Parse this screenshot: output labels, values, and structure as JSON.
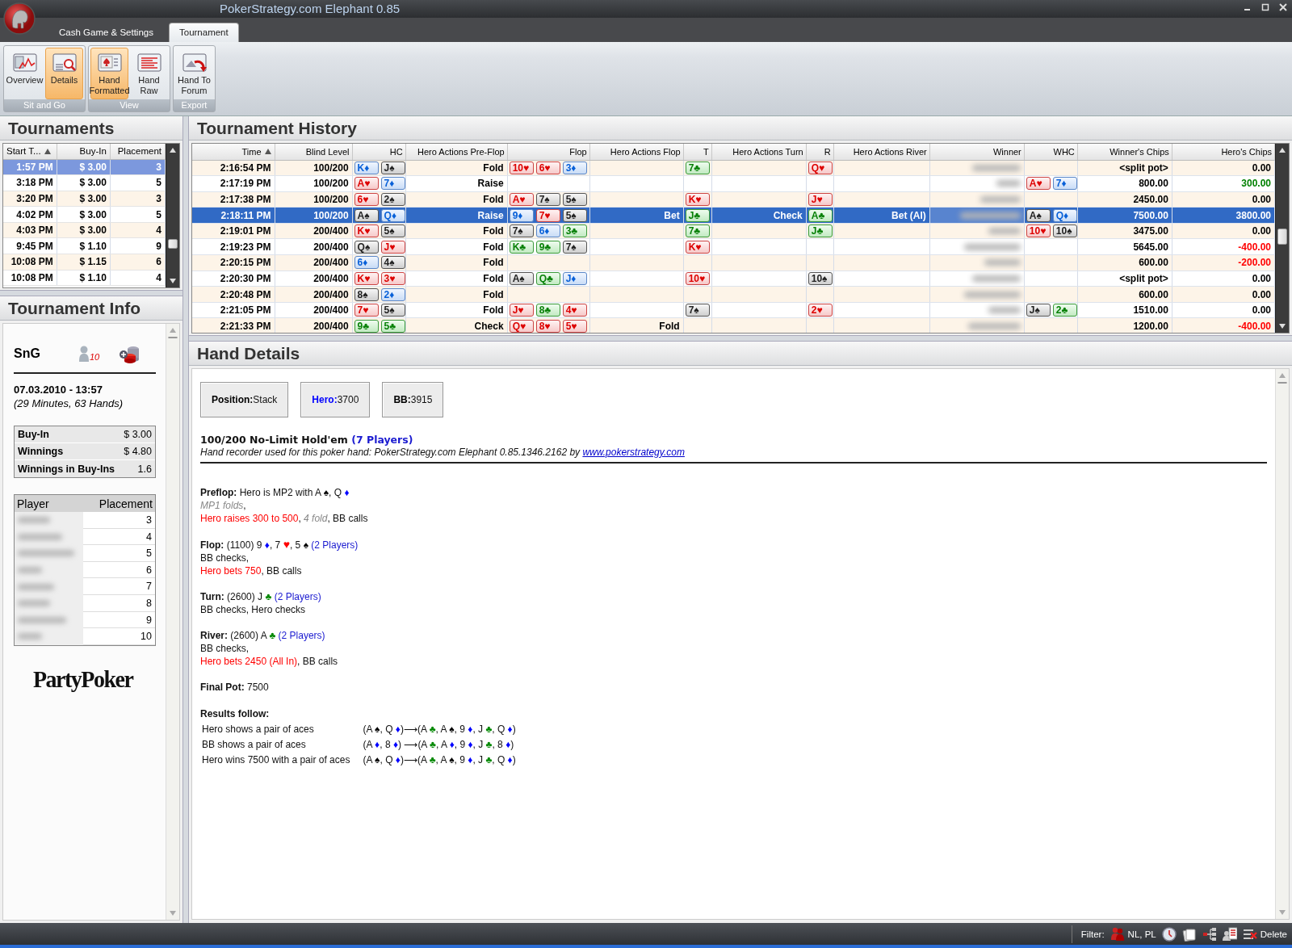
{
  "window": {
    "title": "PokerStrategy.com Elephant 0.85"
  },
  "ribbon": {
    "tabs": [
      {
        "label": "Cash Game & Settings",
        "selected": false
      },
      {
        "label": "Tournament",
        "selected": true
      }
    ],
    "groups": [
      {
        "label": "Sit and Go",
        "buttons": [
          {
            "label": "Overview",
            "kind": "chart",
            "selected": false
          },
          {
            "label": "Details",
            "kind": "details",
            "selected": true
          }
        ]
      },
      {
        "label": "View",
        "buttons": [
          {
            "label": "Hand Formatted",
            "kind": "hand",
            "selected": true
          },
          {
            "label": "Hand Raw",
            "kind": "raw",
            "selected": false
          }
        ]
      },
      {
        "label": "Export",
        "buttons": [
          {
            "label": "Hand To Forum",
            "kind": "forum",
            "selected": false
          }
        ]
      }
    ]
  },
  "tournaments": {
    "title": "Tournaments",
    "columns": [
      {
        "label": "Start T...",
        "sorted": true
      },
      {
        "label": "Buy-In",
        "sorted": false
      },
      {
        "label": "Placement",
        "sorted": false
      }
    ],
    "rows": [
      {
        "start": "1:57 PM",
        "buy_in": "$ 3.00",
        "placement": "3",
        "selected": true
      },
      {
        "start": "3:18 PM",
        "buy_in": "$ 3.00",
        "placement": "5",
        "selected": false
      },
      {
        "start": "3:20 PM",
        "buy_in": "$ 3.00",
        "placement": "3",
        "selected": false
      },
      {
        "start": "4:02 PM",
        "buy_in": "$ 3.00",
        "placement": "5",
        "selected": false
      },
      {
        "start": "4:03 PM",
        "buy_in": "$ 3.00",
        "placement": "4",
        "selected": false
      },
      {
        "start": "9:45 PM",
        "buy_in": "$ 1.10",
        "placement": "9",
        "selected": false
      },
      {
        "start": "10:08 PM",
        "buy_in": "$ 1.15",
        "placement": "6",
        "selected": false
      },
      {
        "start": "10:08 PM",
        "buy_in": "$ 1.10",
        "placement": "4",
        "selected": false
      }
    ]
  },
  "tournament_info": {
    "title": "Tournament Info",
    "type": "SnG",
    "player_count": "10",
    "date": "07.03.2010 - 13:57",
    "duration": "(29 Minutes, 63 Hands)",
    "summary": [
      {
        "label": "Buy-In",
        "value": "$ 3.00"
      },
      {
        "label": "Winnings",
        "value": "$ 4.80"
      },
      {
        "label": "Winnings in Buy-Ins",
        "value": "1.6"
      }
    ],
    "players": {
      "columns": [
        "Player",
        "Placement"
      ],
      "rows": [
        {
          "placement": "3"
        },
        {
          "placement": "4"
        },
        {
          "placement": "5"
        },
        {
          "placement": "6"
        },
        {
          "placement": "7"
        },
        {
          "placement": "8"
        },
        {
          "placement": "9"
        },
        {
          "placement": "10"
        }
      ]
    },
    "logo": "PartyPoker"
  },
  "history": {
    "title": "Tournament History",
    "columns": [
      {
        "label": "Time",
        "sorted": true
      },
      {
        "label": "Blind Level",
        "sorted": false
      },
      {
        "label": "HC",
        "sorted": false
      },
      {
        "label": "Hero Actions Pre-Flop",
        "sorted": false
      },
      {
        "label": "Flop",
        "sorted": false
      },
      {
        "label": "Hero Actions Flop",
        "sorted": false
      },
      {
        "label": "T",
        "sorted": false
      },
      {
        "label": "Hero Actions Turn",
        "sorted": false
      },
      {
        "label": "R",
        "sorted": false
      },
      {
        "label": "Hero Actions River",
        "sorted": false
      },
      {
        "label": "Winner",
        "sorted": false
      },
      {
        "label": "WHC",
        "sorted": false
      },
      {
        "label": "Winner's Chips",
        "sorted": false
      },
      {
        "label": "Hero's Chips",
        "sorted": false
      }
    ],
    "rows": [
      {
        "time": "2:16:54 PM",
        "blind": "100/200",
        "hc": [
          {
            "label": "K♦",
            "kind": "diamonds"
          },
          {
            "label": "J♠",
            "kind": "spades"
          }
        ],
        "pre": "Fold",
        "flop": [
          {
            "label": "10♥",
            "kind": "hearts"
          },
          {
            "label": "6♥",
            "kind": "hearts"
          },
          {
            "label": "3♦",
            "kind": "diamonds"
          }
        ],
        "turn": [
          {
            "label": "7♣",
            "kind": "clubs"
          }
        ],
        "river": [
          {
            "label": "Q♥",
            "kind": "hearts"
          }
        ],
        "winners_chips": "<split pot>",
        "heros_chips": "0.00",
        "color": "#000000",
        "selected": false
      },
      {
        "time": "2:17:19 PM",
        "blind": "100/200",
        "hc": [
          {
            "label": "A♥",
            "kind": "hearts"
          },
          {
            "label": "7♦",
            "kind": "diamonds"
          }
        ],
        "pre": "Raise",
        "whc": [
          {
            "label": "A♥",
            "kind": "hearts"
          },
          {
            "label": "7♦",
            "kind": "diamonds"
          }
        ],
        "winners_chips": "800.00",
        "heros_chips": "300.00",
        "color": "#008000",
        "selected": false
      },
      {
        "time": "2:17:38 PM",
        "blind": "100/200",
        "hc": [
          {
            "label": "6♥",
            "kind": "hearts"
          },
          {
            "label": "2♠",
            "kind": "spades"
          }
        ],
        "pre": "Fold",
        "flop": [
          {
            "label": "A♥",
            "kind": "hearts"
          },
          {
            "label": "7♠",
            "kind": "spades"
          },
          {
            "label": "5♠",
            "kind": "spades"
          }
        ],
        "turn": [
          {
            "label": "K♥",
            "kind": "hearts"
          }
        ],
        "river": [
          {
            "label": "J♥",
            "kind": "hearts"
          }
        ],
        "winners_chips": "2450.00",
        "heros_chips": "0.00",
        "color": "#000000",
        "selected": false
      },
      {
        "time": "2:18:11 PM",
        "blind": "100/200",
        "hc": [
          {
            "label": "A♠",
            "kind": "spades"
          },
          {
            "label": "Q♦",
            "kind": "diamonds"
          }
        ],
        "pre": "Raise",
        "flop": [
          {
            "label": "9♦",
            "kind": "diamonds"
          },
          {
            "label": "7♥",
            "kind": "hearts"
          },
          {
            "label": "5♠",
            "kind": "spades"
          }
        ],
        "flop_action": "Bet",
        "turn": [
          {
            "label": "J♣",
            "kind": "clubs"
          }
        ],
        "turn_action": "Check",
        "river": [
          {
            "label": "A♣",
            "kind": "clubs"
          }
        ],
        "river_action": "Bet (AI)",
        "whc": [
          {
            "label": "A♠",
            "kind": "spades"
          },
          {
            "label": "Q♦",
            "kind": "diamonds"
          }
        ],
        "winners_chips": "7500.00",
        "heros_chips": "3800.00",
        "selected": true
      },
      {
        "time": "2:19:01 PM",
        "blind": "200/400",
        "hc": [
          {
            "label": "K♥",
            "kind": "hearts"
          },
          {
            "label": "5♠",
            "kind": "spades"
          }
        ],
        "pre": "Fold",
        "flop": [
          {
            "label": "7♠",
            "kind": "spades"
          },
          {
            "label": "6♦",
            "kind": "diamonds"
          },
          {
            "label": "3♣",
            "kind": "clubs"
          }
        ],
        "turn": [
          {
            "label": "7♣",
            "kind": "clubs"
          }
        ],
        "river": [
          {
            "label": "J♣",
            "kind": "clubs"
          }
        ],
        "whc": [
          {
            "label": "10♥",
            "kind": "hearts"
          },
          {
            "label": "10♠",
            "kind": "spades"
          }
        ],
        "winners_chips": "3475.00",
        "heros_chips": "0.00",
        "color": "#000000",
        "selected": false
      },
      {
        "time": "2:19:23 PM",
        "blind": "200/400",
        "hc": [
          {
            "label": "Q♠",
            "kind": "spades"
          },
          {
            "label": "J♥",
            "kind": "hearts"
          }
        ],
        "pre": "Fold",
        "flop": [
          {
            "label": "K♣",
            "kind": "clubs"
          },
          {
            "label": "9♣",
            "kind": "clubs"
          },
          {
            "label": "7♠",
            "kind": "spades"
          }
        ],
        "turn": [
          {
            "label": "K♥",
            "kind": "hearts"
          }
        ],
        "winners_chips": "5645.00",
        "heros_chips": "-400.00",
        "color": "#ff0000",
        "selected": false
      },
      {
        "time": "2:20:15 PM",
        "blind": "200/400",
        "hc": [
          {
            "label": "6♦",
            "kind": "diamonds"
          },
          {
            "label": "4♠",
            "kind": "spades"
          }
        ],
        "pre": "Fold",
        "winners_chips": "600.00",
        "heros_chips": "-200.00",
        "color": "#ff0000",
        "selected": false
      },
      {
        "time": "2:20:30 PM",
        "blind": "200/400",
        "hc": [
          {
            "label": "K♥",
            "kind": "hearts"
          },
          {
            "label": "3♥",
            "kind": "hearts"
          }
        ],
        "pre": "Fold",
        "flop": [
          {
            "label": "A♠",
            "kind": "spades"
          },
          {
            "label": "Q♣",
            "kind": "clubs"
          },
          {
            "label": "J♦",
            "kind": "diamonds"
          }
        ],
        "turn": [
          {
            "label": "10♥",
            "kind": "hearts"
          }
        ],
        "river": [
          {
            "label": "10♠",
            "kind": "spades"
          }
        ],
        "winners_chips": "<split pot>",
        "heros_chips": "0.00",
        "color": "#000000",
        "selected": false
      },
      {
        "time": "2:20:48 PM",
        "blind": "200/400",
        "hc": [
          {
            "label": "8♠",
            "kind": "spades"
          },
          {
            "label": "2♦",
            "kind": "diamonds"
          }
        ],
        "pre": "Fold",
        "winners_chips": "600.00",
        "heros_chips": "0.00",
        "color": "#000000",
        "selected": false
      },
      {
        "time": "2:21:05 PM",
        "blind": "200/400",
        "hc": [
          {
            "label": "7♥",
            "kind": "hearts"
          },
          {
            "label": "5♠",
            "kind": "spades"
          }
        ],
        "pre": "Fold",
        "flop": [
          {
            "label": "J♥",
            "kind": "hearts"
          },
          {
            "label": "8♣",
            "kind": "clubs"
          },
          {
            "label": "4♥",
            "kind": "hearts"
          }
        ],
        "turn": [
          {
            "label": "7♠",
            "kind": "spades"
          }
        ],
        "river": [
          {
            "label": "2♥",
            "kind": "hearts"
          }
        ],
        "whc": [
          {
            "label": "J♠",
            "kind": "spades"
          },
          {
            "label": "2♣",
            "kind": "clubs"
          }
        ],
        "winners_chips": "1510.00",
        "heros_chips": "0.00",
        "color": "#000000",
        "selected": false
      },
      {
        "time": "2:21:33 PM",
        "blind": "200/400",
        "hc": [
          {
            "label": "9♣",
            "kind": "clubs"
          },
          {
            "label": "5♣",
            "kind": "clubs"
          }
        ],
        "pre": "Check",
        "flop": [
          {
            "label": "Q♥",
            "kind": "hearts"
          },
          {
            "label": "8♥",
            "kind": "hearts"
          },
          {
            "label": "5♥",
            "kind": "hearts"
          }
        ],
        "flop_action": "Fold",
        "winners_chips": "1200.00",
        "heros_chips": "-400.00",
        "color": "#ff0000",
        "selected": false
      }
    ]
  },
  "hand_details": {
    "title": "Hand Details",
    "stats": [
      {
        "label": "Position:",
        "value": "Stack",
        "color": "#000000"
      },
      {
        "label": "Hero:",
        "value": "3700",
        "color": "#0000ff"
      },
      {
        "label": "BB:",
        "value": "3915",
        "color": "#000000"
      }
    ],
    "game": "100/200 No-Limit Hold'em",
    "game_players": "(7 Players)",
    "recorder": "Hand recorder used for this poker hand: PokerStrategy.com Elephant 0.85.1346.2162 by",
    "link": "www.pokerstrategy.com",
    "paragraphs": [
      [
        [
          {
            "text": "Preflop:",
            "kind": "bold"
          },
          {
            "text": " Hero is MP2 with A ",
            "kind": "plain"
          },
          {
            "text": "♠",
            "kind": "spade"
          },
          {
            "text": ", Q ",
            "kind": "plain"
          },
          {
            "text": "♦",
            "kind": "diamond"
          }
        ],
        [
          {
            "text": "MP1 folds",
            "kind": "folded"
          },
          {
            "text": ",",
            "kind": "plain"
          }
        ],
        [
          {
            "text": "Hero raises 300 to 500",
            "kind": "hero"
          },
          {
            "text": ", ",
            "kind": "plain"
          },
          {
            "text": "4 fold",
            "kind": "folded"
          },
          {
            "text": ", BB calls",
            "kind": "plain"
          }
        ]
      ],
      [
        [
          {
            "text": "Flop:",
            "kind": "bold"
          },
          {
            "text": " (1100) 9 ",
            "kind": "plain"
          },
          {
            "text": "♦",
            "kind": "diamond"
          },
          {
            "text": ", 7 ",
            "kind": "plain"
          },
          {
            "text": "♥",
            "kind": "heart"
          },
          {
            "text": ", 5 ",
            "kind": "plain"
          },
          {
            "text": "♠",
            "kind": "spade"
          },
          {
            "text": " (2 Players)",
            "kind": "players"
          }
        ],
        [
          {
            "text": "BB checks,",
            "kind": "plain"
          }
        ],
        [
          {
            "text": "Hero bets 750",
            "kind": "hero"
          },
          {
            "text": ", BB calls",
            "kind": "plain"
          }
        ]
      ],
      [
        [
          {
            "text": "Turn:",
            "kind": "bold"
          },
          {
            "text": " (2600) J ",
            "kind": "plain"
          },
          {
            "text": "♣",
            "kind": "club"
          },
          {
            "text": " (2 Players)",
            "kind": "players"
          }
        ],
        [
          {
            "text": "BB checks, Hero checks",
            "kind": "plain"
          }
        ]
      ],
      [
        [
          {
            "text": "River:",
            "kind": "bold"
          },
          {
            "text": " (2600) A ",
            "kind": "plain"
          },
          {
            "text": "♣",
            "kind": "club"
          },
          {
            "text": " (2 Players)",
            "kind": "players"
          }
        ],
        [
          {
            "text": "BB checks,",
            "kind": "plain"
          }
        ],
        [
          {
            "text": "Hero bets 2450 (All In)",
            "kind": "hero"
          },
          {
            "text": ", BB calls",
            "kind": "plain"
          }
        ]
      ],
      [
        [
          {
            "text": "Final Pot:",
            "kind": "bold"
          },
          {
            "text": " 7500",
            "kind": "plain"
          }
        ]
      ]
    ],
    "results_title": "Results follow:",
    "results": [
      {
        "text": "Hero shows a pair of aces",
        "hand": [
          {
            "text": "(A ",
            "kind": "plain"
          },
          {
            "text": "♠",
            "kind": "spade"
          },
          {
            "text": ", Q ",
            "kind": "plain"
          },
          {
            "text": "♦",
            "kind": "diamond"
          },
          {
            "text": ")⟶(A ",
            "kind": "plain"
          },
          {
            "text": "♣",
            "kind": "club"
          },
          {
            "text": ", A ",
            "kind": "plain"
          },
          {
            "text": "♠",
            "kind": "spade"
          },
          {
            "text": ", 9 ",
            "kind": "plain"
          },
          {
            "text": "♦",
            "kind": "diamond"
          },
          {
            "text": ", J ",
            "kind": "plain"
          },
          {
            "text": "♣",
            "kind": "club"
          },
          {
            "text": ", Q ",
            "kind": "plain"
          },
          {
            "text": "♦",
            "kind": "diamond"
          },
          {
            "text": ")",
            "kind": "plain"
          }
        ]
      },
      {
        "text": "BB shows a pair of aces",
        "hand": [
          {
            "text": "(A ",
            "kind": "plain"
          },
          {
            "text": "♦",
            "kind": "diamond"
          },
          {
            "text": ", 8 ",
            "kind": "plain"
          },
          {
            "text": "♦",
            "kind": "diamond"
          },
          {
            "text": ") ⟶(A ",
            "kind": "plain"
          },
          {
            "text": "♣",
            "kind": "club"
          },
          {
            "text": ", A ",
            "kind": "plain"
          },
          {
            "text": "♦",
            "kind": "diamond"
          },
          {
            "text": ", 9 ",
            "kind": "plain"
          },
          {
            "text": "♦",
            "kind": "diamond"
          },
          {
            "text": ", J ",
            "kind": "plain"
          },
          {
            "text": "♣",
            "kind": "club"
          },
          {
            "text": ", 8 ",
            "kind": "plain"
          },
          {
            "text": "♦",
            "kind": "diamond"
          },
          {
            "text": ")",
            "kind": "plain"
          }
        ]
      },
      {
        "text": "Hero wins 7500 with a pair of aces",
        "hand": [
          {
            "text": "(A ",
            "kind": "plain"
          },
          {
            "text": "♠",
            "kind": "spade"
          },
          {
            "text": ", Q ",
            "kind": "plain"
          },
          {
            "text": "♦",
            "kind": "diamond"
          },
          {
            "text": ")⟶(A ",
            "kind": "plain"
          },
          {
            "text": "♣",
            "kind": "club"
          },
          {
            "text": ", A ",
            "kind": "plain"
          },
          {
            "text": "♠",
            "kind": "spade"
          },
          {
            "text": ", 9 ",
            "kind": "plain"
          },
          {
            "text": "♦",
            "kind": "diamond"
          },
          {
            "text": ", J ",
            "kind": "plain"
          },
          {
            "text": "♣",
            "kind": "club"
          },
          {
            "text": ", Q ",
            "kind": "plain"
          },
          {
            "text": "♦",
            "kind": "diamond"
          },
          {
            "text": ")",
            "kind": "plain"
          }
        ]
      }
    ]
  },
  "status_bar": {
    "filter_label": "Filter:",
    "filter_value": "NL, PL",
    "delete": "Delete"
  }
}
